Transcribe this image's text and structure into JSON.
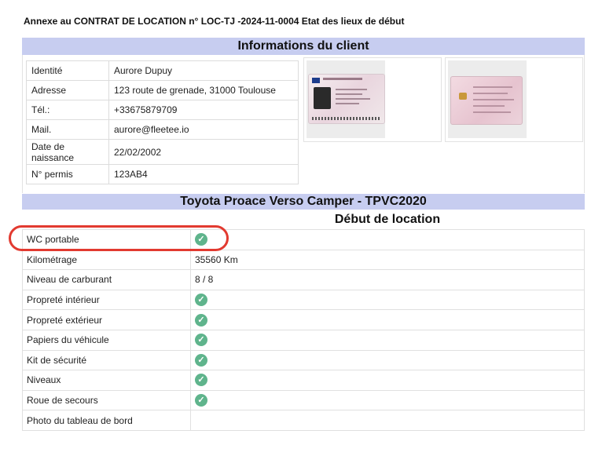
{
  "header": {
    "title": "Annexe au CONTRAT DE LOCATION n° LOC-TJ -2024-11-0004 Etat des lieux de début"
  },
  "client_section": {
    "title": "Informations du client",
    "fields": [
      {
        "label": "Identité",
        "value": "Aurore Dupuy"
      },
      {
        "label": "Adresse",
        "value": "123 route de grenade, 31000 Toulouse"
      },
      {
        "label": "Tél.:",
        "value": "+33675879709"
      },
      {
        "label": "Mail.",
        "value": "aurore@fleetee.io"
      },
      {
        "label": "Date de naissance",
        "value": "22/02/2002"
      },
      {
        "label": "N° permis",
        "value": "123AB4"
      }
    ]
  },
  "vehicle_section": {
    "title": "Toyota Proace Verso Camper - TPVC2020",
    "column_header": "Début de location",
    "rows": [
      {
        "label": "WC portable",
        "value": "",
        "check": true
      },
      {
        "label": "Kilométrage",
        "value": "35560 Km",
        "check": false
      },
      {
        "label": "Niveau de carburant",
        "value": "8 / 8",
        "check": false
      },
      {
        "label": "Propreté intérieur",
        "value": "",
        "check": true
      },
      {
        "label": "Propreté extérieur",
        "value": "",
        "check": true
      },
      {
        "label": "Papiers du véhicule",
        "value": "",
        "check": true
      },
      {
        "label": "Kit de sécurité",
        "value": "",
        "check": true
      },
      {
        "label": "Niveaux",
        "value": "",
        "check": true
      },
      {
        "label": "Roue de secours",
        "value": "",
        "check": true
      },
      {
        "label": "Photo du tableau de bord",
        "value": "",
        "check": false
      }
    ]
  },
  "icons": {
    "check": "check-circle-icon"
  },
  "colors": {
    "band": "#c7cdf0",
    "check": "#5fb48c",
    "highlight": "#e23a30"
  }
}
